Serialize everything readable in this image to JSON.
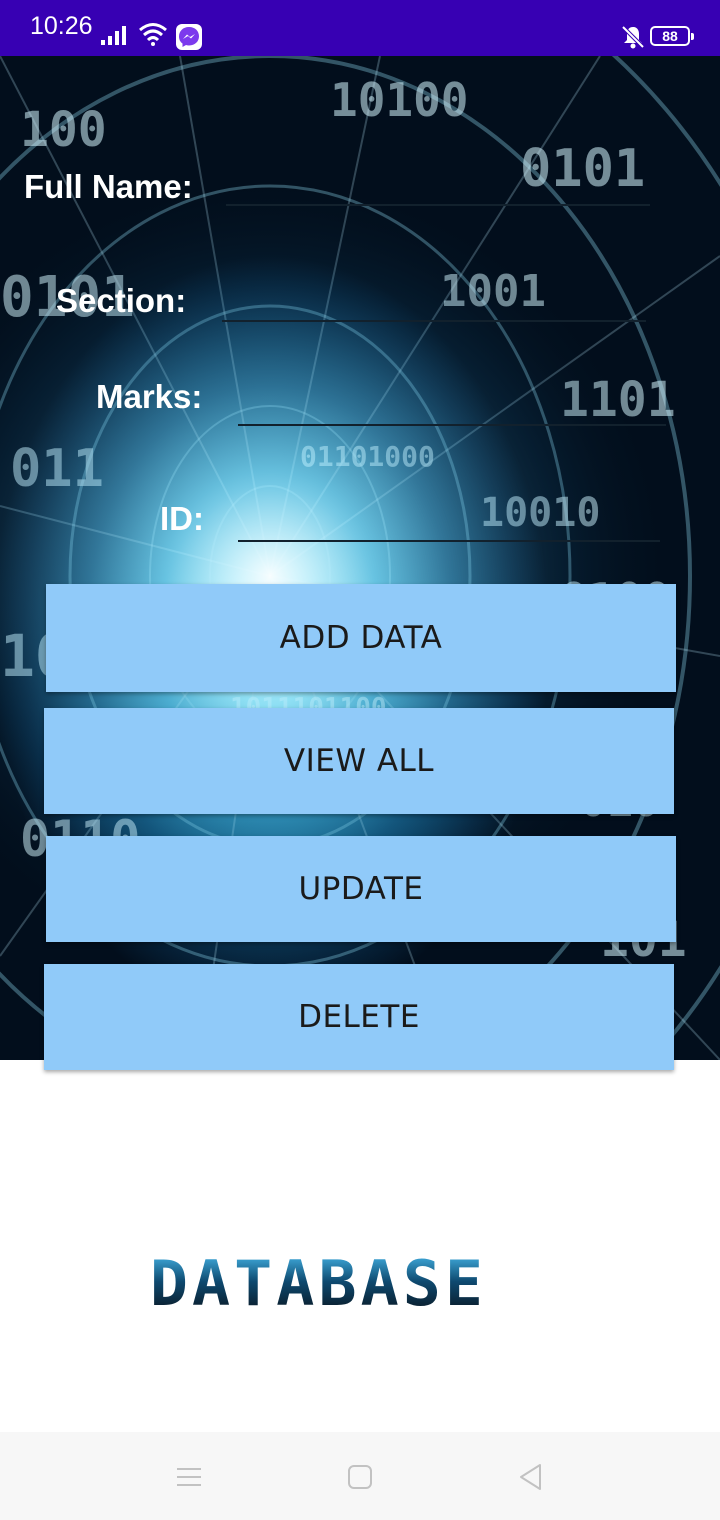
{
  "status_bar": {
    "time": "10:26",
    "battery": "88",
    "background_color": "#3700b3",
    "icons": [
      "signal-icon",
      "wifi-icon",
      "messenger-icon",
      "notifications-off-icon",
      "battery-icon"
    ]
  },
  "form": {
    "full_name_label": "Full Name:",
    "section_label": "Section:",
    "marks_label": "Marks:",
    "id_label": "ID:",
    "full_name_value": "",
    "section_value": "",
    "marks_value": "",
    "id_value": ""
  },
  "buttons": {
    "add_label": "ADD DATA",
    "view_label": "VIEW ALL",
    "update_label": "UPDATE",
    "delete_label": "DELETE",
    "color": "#90caf9"
  },
  "logo": {
    "text": "DATABASE"
  },
  "nav_bar": {
    "icons": [
      "menu-icon",
      "home-icon",
      "back-icon"
    ]
  }
}
